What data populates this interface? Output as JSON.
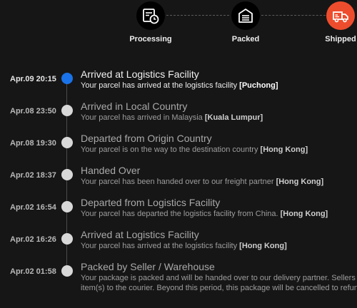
{
  "progress": {
    "steps": [
      {
        "label": "Processing",
        "icon": "invoice-clock-icon",
        "state": "done"
      },
      {
        "label": "Packed",
        "icon": "warehouse-icon",
        "state": "done"
      },
      {
        "label": "Shipped",
        "icon": "truck-icon",
        "state": "active"
      }
    ],
    "active_color": "#ee4d2d"
  },
  "timeline": {
    "current_color": "#1a73e8",
    "events": [
      {
        "time": "Apr.09 20:15",
        "title": "Arrived at Logistics Facility",
        "desc": "Your parcel has arrived at the logistics facility ",
        "location": "[Puchong]",
        "current": true
      },
      {
        "time": "Apr.08 23:50",
        "title": "Arrived in Local Country",
        "desc": "Your parcel has arrived in Malaysia ",
        "location": "[Kuala Lumpur]"
      },
      {
        "time": "Apr.08 19:30",
        "title": "Departed from Origin Country",
        "desc": "Your parcel is on the way to the destination country ",
        "location": "[Hong Kong]"
      },
      {
        "time": "Apr.02 18:37",
        "title": "Handed Over",
        "desc": "Your parcel has been handed over to our freight partner ",
        "location": "[Hong Kong]"
      },
      {
        "time": "Apr.02 16:54",
        "title": "Departed from Logistics Facility",
        "desc": "Your parcel has departed the logistics facility from China. ",
        "location": "[Hong Kong]"
      },
      {
        "time": "Apr.02 16:26",
        "title": "Arrived at Logistics Facility",
        "desc": "Your parcel has arrived at the logistics facility ",
        "location": "[Hong Kong]"
      },
      {
        "time": "Apr.02 01:58",
        "title": "Packed by Seller / Warehouse",
        "desc": "Your package is packed and will be handed over to our delivery partner. Sellers a",
        "desc2": "item(s) to the courier. Beyond this period, this package will be cancelled to refun"
      }
    ]
  }
}
